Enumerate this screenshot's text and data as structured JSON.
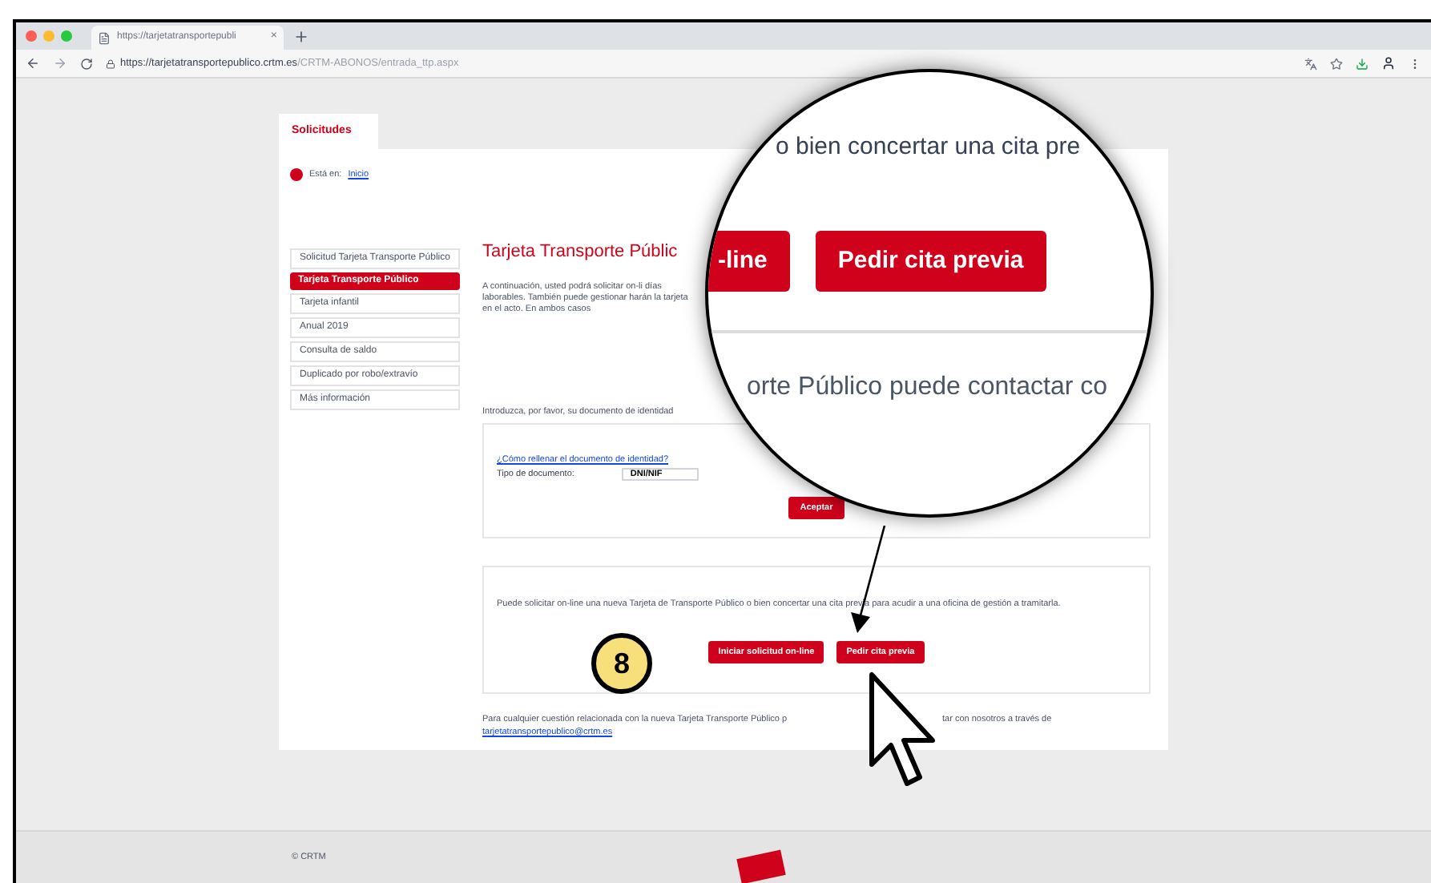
{
  "browser": {
    "tab_title": "https://tarjetatransportepubli",
    "tab_close": "×",
    "url_host": "https://tarjetatransportepublico.crtm.es",
    "url_path": "/CRTM-ABONOS/entrada_ttp.aspx"
  },
  "page": {
    "section_tab": "Solicitudes",
    "breadcrumb_label": "Está en:",
    "breadcrumb_link": "Inicio",
    "sidebar": [
      {
        "label": "Solicitud Tarjeta Transporte Público",
        "selected": false
      },
      {
        "label": "Tarjeta Transporte Público",
        "selected": true
      },
      {
        "label": "Tarjeta infantil",
        "selected": false
      },
      {
        "label": "Anual 2019",
        "selected": false
      },
      {
        "label": "Consulta de saldo",
        "selected": false
      },
      {
        "label": "Duplicado por robo/extravío",
        "selected": false
      },
      {
        "label": "Más información",
        "selected": false
      }
    ],
    "title": "Tarjeta Transporte Públic",
    "intro": "A continuación, usted podrá solicitar on-li días laborables. También puede gestionar harán la tarjeta en el acto. En ambos casos",
    "id_prompt": "Introduzca, por favor, su documento de identidad",
    "help_link": "¿Cómo rellenar el documento de identidad?",
    "doc_type_label": "Tipo de documento:",
    "doc_type_value": "DNI/NIF",
    "accept_button": "Aceptar",
    "online_text": "Puede solicitar on-line una nueva Tarjeta de Transporte Público o bien concertar una cita previa para acudir a una oficina de gestión a tramitarla.",
    "buttons": [
      "Iniciar solicitud on-line",
      "Pedir cita previa"
    ],
    "contact_text_start": "Para cualquier cuestión relacionada con la nueva Tarjeta Transporte Público p",
    "contact_text_end": "tar con nosotros a través de",
    "contact_email": "tarjetatransportepublico@crtm.es",
    "footer_copyright": "© CRTM"
  },
  "magnifier": {
    "text_top": "o bien concertar una cita pre",
    "buttons": [
      "-line",
      "Pedir cita previa"
    ],
    "text_bottom": "orte Público puede contactar co"
  },
  "step_badge": "8"
}
